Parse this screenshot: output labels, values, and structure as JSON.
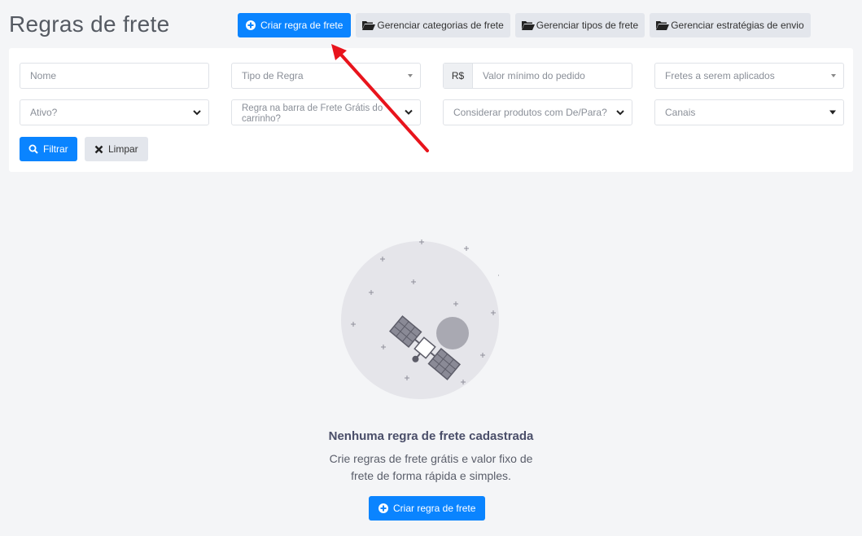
{
  "header": {
    "title": "Regras de frete",
    "actions": {
      "create": "Criar regra de frete",
      "categories": "Gerenciar categorias de frete",
      "types": "Gerenciar tipos de frete",
      "strategies": "Gerenciar estratégias de envio"
    }
  },
  "filters": {
    "name_placeholder": "Nome",
    "rule_type_placeholder": "Tipo de Regra",
    "currency_prefix": "R$",
    "min_order_placeholder": "Valor mínimo do pedido",
    "shipping_applied_placeholder": "Fretes a serem aplicados",
    "active_placeholder": "Ativo?",
    "free_shipping_bar_placeholder": "Regra na barra de Frete Grátis do carrinho?",
    "depara_placeholder": "Considerar produtos com De/Para?",
    "channels_placeholder": "Canais",
    "filter_button": "Filtrar",
    "clear_button": "Limpar"
  },
  "empty_state": {
    "title": "Nenhuma regra de frete cadastrada",
    "description_line1": "Crie regras de frete grátis e valor fixo de",
    "description_line2": "frete de forma rápida e simples.",
    "cta": "Criar regra de frete"
  },
  "colors": {
    "primary": "#0a84ff",
    "annotation_arrow": "#e8141c"
  },
  "icons": {
    "create": "plus-circle-icon",
    "manage": "folder-open-icon",
    "filter": "search-icon",
    "clear": "x-icon",
    "illustration": "satellite-icon"
  }
}
